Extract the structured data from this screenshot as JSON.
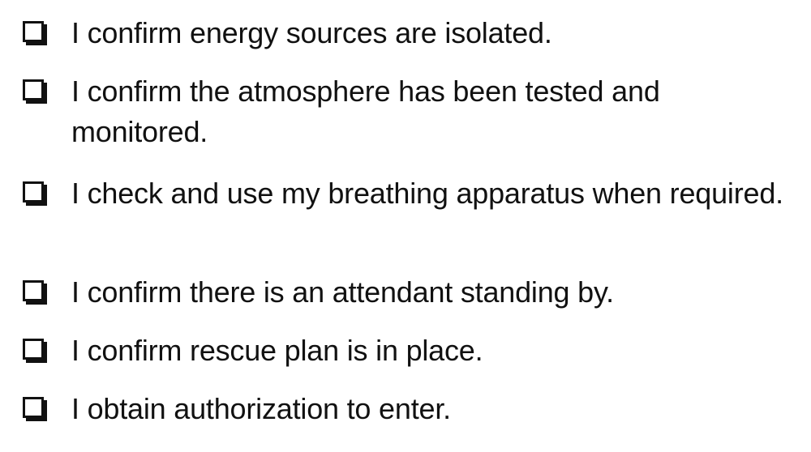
{
  "checklist": {
    "items": [
      {
        "text": "I confirm energy sources are isolated.",
        "checked": false
      },
      {
        "text": "I confirm the atmosphere has been tested and monitored.",
        "checked": false
      },
      {
        "text": "I check and use my breathing apparatus when required.",
        "checked": false
      },
      {
        "text": "I confirm there is an attendant standing by.",
        "checked": false
      },
      {
        "text": "I confirm rescue plan is in place.",
        "checked": false
      },
      {
        "text": "I obtain authorization to enter.",
        "checked": false
      }
    ]
  }
}
